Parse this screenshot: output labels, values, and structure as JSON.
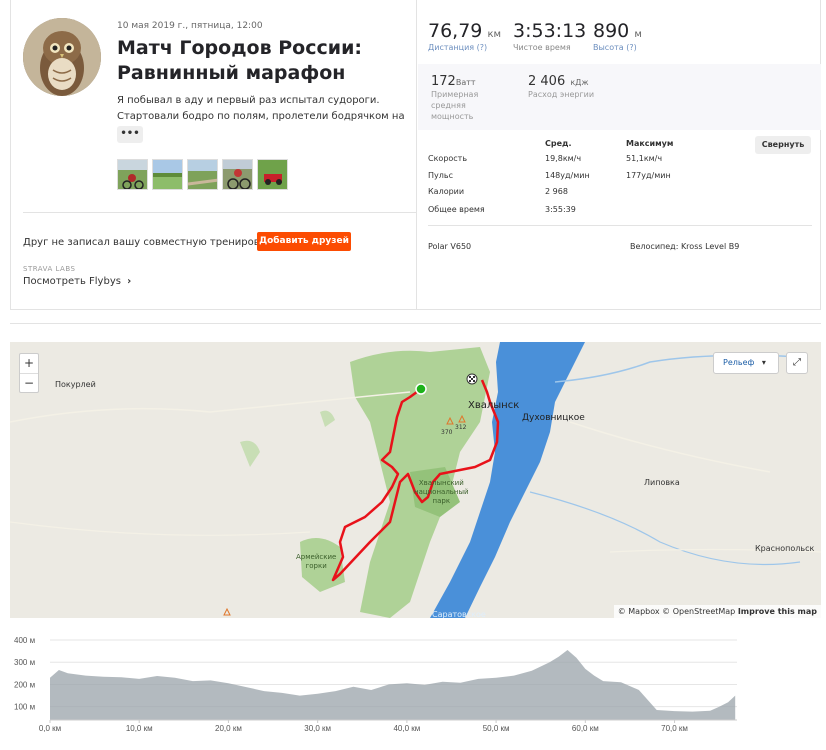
{
  "activity": {
    "date": "10 мая 2019 г., пятница, 12:00",
    "title_line1": "Матч Городов России:",
    "title_line2": "Равнинный марафон",
    "desc_line1": "Я побывал в аду и первый раз испытал судороги.",
    "desc_line2": "Стартовали бодро по полям, пролетели бодрячком на",
    "more_label": "•••"
  },
  "friends": {
    "text": "Друг не записал вашу совместную тренировку?",
    "button": "Добавить друзей"
  },
  "labs": {
    "tag": "STRAVA LABS",
    "link": "Посмотреть Flybys",
    "link_arrow": "›"
  },
  "stats": {
    "distance": {
      "value": "76,79",
      "unit": "км",
      "label": "Дистанция (?)"
    },
    "moving_time": {
      "value": "3:53:13",
      "label": "Чистое время"
    },
    "elevation": {
      "value": "890",
      "unit": "м",
      "label": "Высота (?)"
    },
    "power": {
      "value": "172",
      "unit": "Ватт",
      "label1": "Примерная",
      "label2": "средняя",
      "label3": "мощность"
    },
    "energy": {
      "value": "2 406",
      "unit": "кДж",
      "label": "Расход энергии"
    }
  },
  "table": {
    "col_avg": "Сред.",
    "col_max": "Максимум",
    "collapse": "Свернуть",
    "rows": [
      {
        "label": "Скорость",
        "avg": "19,8км/ч",
        "max": "51,1км/ч"
      },
      {
        "label": "Пульс",
        "avg": "148уд/мин",
        "max": "177уд/мин"
      },
      {
        "label": "Калории",
        "avg": "2 968",
        "max": ""
      },
      {
        "label": "Общее время",
        "avg": "3:55:39",
        "max": ""
      }
    ]
  },
  "gear": {
    "device": "Polar V650",
    "bike": "Велосипед: Kross Level B9"
  },
  "map": {
    "zoom_in": "+",
    "zoom_out": "−",
    "layer": "Рельеф",
    "layer_arrow": "▾",
    "fullscreen": "⤢",
    "attribution_mapbox": "© Mapbox",
    "attribution_osm": "© OpenStreetMap",
    "attribution_improve": "Improve this map",
    "places": {
      "pokurley": "Покурлей",
      "khvalynsk": "Хвалынск",
      "dukhovnitskoe": "Духовницкое",
      "lipovka": "Липовка",
      "krasnopolskoe": "Краснопольск",
      "park1": "Хвалынский",
      "park2": "национальный",
      "park3": "парк",
      "gorki1": "Армейские",
      "gorki2": "горки",
      "peak1": "370",
      "peak2": "312",
      "saratov": "Саратовское"
    },
    "colors": {
      "route": "#e8121a",
      "water": "#4a90d9",
      "forest": "#a8cf8e",
      "start": "#1db21a"
    }
  },
  "chart_data": {
    "type": "area",
    "y_ticks": [
      "400 м",
      "300 м",
      "200 м",
      "100 м"
    ],
    "x_ticks": [
      "0,0 км",
      "10,0 км",
      "20,0 км",
      "30,0 км",
      "40,0 км",
      "50,0 км",
      "60,0 км",
      "70,0 км"
    ],
    "xlim": [
      0,
      77
    ],
    "ylim": [
      40,
      400
    ],
    "x": [
      0,
      1,
      2,
      4,
      6,
      8,
      10,
      12,
      14,
      16,
      18,
      20,
      22,
      24,
      26,
      28,
      30,
      32,
      34,
      36,
      38,
      40,
      42,
      44,
      46,
      48,
      50,
      52,
      54,
      56,
      57,
      58,
      59,
      60,
      61,
      62,
      64,
      66,
      68,
      70,
      72,
      74,
      75,
      76,
      76.8
    ],
    "y": [
      230,
      265,
      250,
      240,
      235,
      232,
      225,
      238,
      230,
      215,
      218,
      205,
      188,
      170,
      162,
      150,
      158,
      170,
      190,
      175,
      200,
      205,
      198,
      212,
      208,
      225,
      230,
      240,
      262,
      300,
      325,
      355,
      320,
      270,
      240,
      215,
      210,
      175,
      85,
      80,
      78,
      82,
      100,
      120,
      150
    ],
    "ylabel": "",
    "xlabel": "",
    "color": "#9aa3a9"
  }
}
